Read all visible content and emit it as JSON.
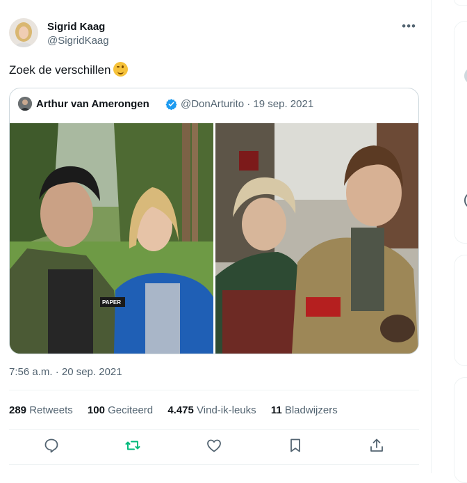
{
  "tweet": {
    "author_name": "Sigrid Kaag",
    "author_handle": "@SigridKaag",
    "text": "Zoek de verschillen",
    "emoji_icon": "winking-face-icon",
    "timestamp": "7:56 a.m. · 20 sep. 2021"
  },
  "quoted": {
    "author_name": "Arthur van Amerongen",
    "verified_icon": "verified-badge-icon",
    "handle_date": "@DonArturito · 19 sep. 2021",
    "patch_text": "PAPER"
  },
  "stats": [
    {
      "count": "289",
      "label": "Retweets"
    },
    {
      "count": "100",
      "label": "Geciteerd"
    },
    {
      "count": "4.475",
      "label": "Vind-ik-leuks"
    },
    {
      "count": "11",
      "label": "Bladwijzers"
    }
  ],
  "colors": {
    "text": "#0f1419",
    "secondary": "#536471",
    "retweet_green": "#00ba7c",
    "verified_blue": "#1d9bf0",
    "border": "#cfd9de"
  }
}
